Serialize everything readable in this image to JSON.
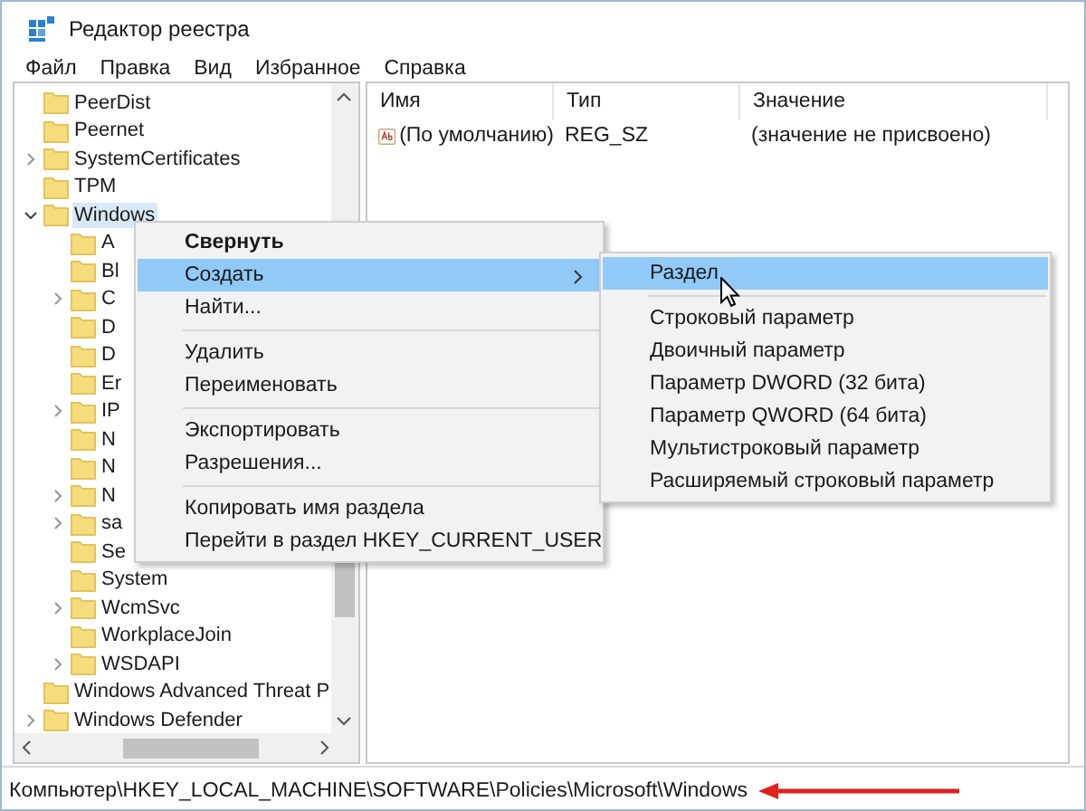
{
  "window": {
    "title": "Редактор реестра"
  },
  "menu_bar": [
    "Файл",
    "Правка",
    "Вид",
    "Избранное",
    "Справка"
  ],
  "tree": [
    {
      "label": "PeerDist",
      "kind": "leaf",
      "selected": false
    },
    {
      "label": "Peernet",
      "kind": "leaf",
      "selected": false
    },
    {
      "label": "SystemCertificates",
      "kind": "collapsed",
      "selected": false
    },
    {
      "label": "TPM",
      "kind": "leaf",
      "selected": false
    },
    {
      "label": "Windows",
      "kind": "expanded",
      "selected": true,
      "children": [
        {
          "label": "A",
          "kind": "leaf",
          "selected": false
        },
        {
          "label": "Bl",
          "kind": "leaf",
          "selected": false
        },
        {
          "label": "C",
          "kind": "collapsed",
          "selected": false
        },
        {
          "label": "D",
          "kind": "leaf",
          "selected": false
        },
        {
          "label": "D",
          "kind": "leaf",
          "selected": false
        },
        {
          "label": "Er",
          "kind": "leaf",
          "selected": false
        },
        {
          "label": "IP",
          "kind": "collapsed",
          "selected": false
        },
        {
          "label": "N",
          "kind": "leaf",
          "selected": false
        },
        {
          "label": "N",
          "kind": "leaf",
          "selected": false
        },
        {
          "label": "N",
          "kind": "collapsed",
          "selected": false
        },
        {
          "label": "sa",
          "kind": "collapsed",
          "selected": false
        },
        {
          "label": "Se",
          "kind": "leaf",
          "selected": false
        },
        {
          "label": "System",
          "kind": "leaf",
          "selected": false
        },
        {
          "label": "WcmSvc",
          "kind": "collapsed",
          "selected": false
        },
        {
          "label": "WorkplaceJoin",
          "kind": "leaf",
          "selected": false
        },
        {
          "label": "WSDAPI",
          "kind": "collapsed",
          "selected": false
        }
      ]
    },
    {
      "label": "Windows Advanced Threat P",
      "kind": "leaf",
      "selected": false
    },
    {
      "label": "Windows Defender",
      "kind": "collapsed",
      "selected": false
    }
  ],
  "values_table": {
    "columns": [
      "Имя",
      "Тип",
      "Значение"
    ],
    "rows": [
      {
        "name": "(По умолчанию)",
        "type": "REG_SZ",
        "value": "(значение не присвоено)"
      }
    ]
  },
  "context_menu": [
    {
      "kind": "item",
      "label": "Свернуть",
      "default": true,
      "selected": false,
      "submenu": false
    },
    {
      "kind": "item",
      "label": "Создать",
      "default": false,
      "selected": true,
      "submenu": true
    },
    {
      "kind": "item",
      "label": "Найти...",
      "default": false,
      "selected": false,
      "submenu": false
    },
    {
      "kind": "separator"
    },
    {
      "kind": "item",
      "label": "Удалить",
      "default": false,
      "selected": false,
      "submenu": false
    },
    {
      "kind": "item",
      "label": "Переименовать",
      "default": false,
      "selected": false,
      "submenu": false
    },
    {
      "kind": "separator"
    },
    {
      "kind": "item",
      "label": "Экспортировать",
      "default": false,
      "selected": false,
      "submenu": false
    },
    {
      "kind": "item",
      "label": "Разрешения...",
      "default": false,
      "selected": false,
      "submenu": false
    },
    {
      "kind": "separator"
    },
    {
      "kind": "item",
      "label": "Копировать имя раздела",
      "default": false,
      "selected": false,
      "submenu": false
    },
    {
      "kind": "item",
      "label": "Перейти в раздел HKEY_CURRENT_USER",
      "default": false,
      "selected": false,
      "submenu": false
    }
  ],
  "submenu": [
    {
      "kind": "item",
      "label": "Раздел",
      "selected": true
    },
    {
      "kind": "separator"
    },
    {
      "kind": "item",
      "label": "Строковый параметр",
      "selected": false
    },
    {
      "kind": "item",
      "label": "Двоичный параметр",
      "selected": false
    },
    {
      "kind": "item",
      "label": "Параметр DWORD (32 бита)",
      "selected": false
    },
    {
      "kind": "item",
      "label": "Параметр QWORD (64 бита)",
      "selected": false
    },
    {
      "kind": "item",
      "label": "Мультистроковый параметр",
      "selected": false
    },
    {
      "kind": "item",
      "label": "Расширяемый строковый параметр",
      "selected": false
    }
  ],
  "status_bar": {
    "path": "Компьютер\\HKEY_LOCAL_MACHINE\\SOFTWARE\\Policies\\Microsoft\\Windows"
  }
}
